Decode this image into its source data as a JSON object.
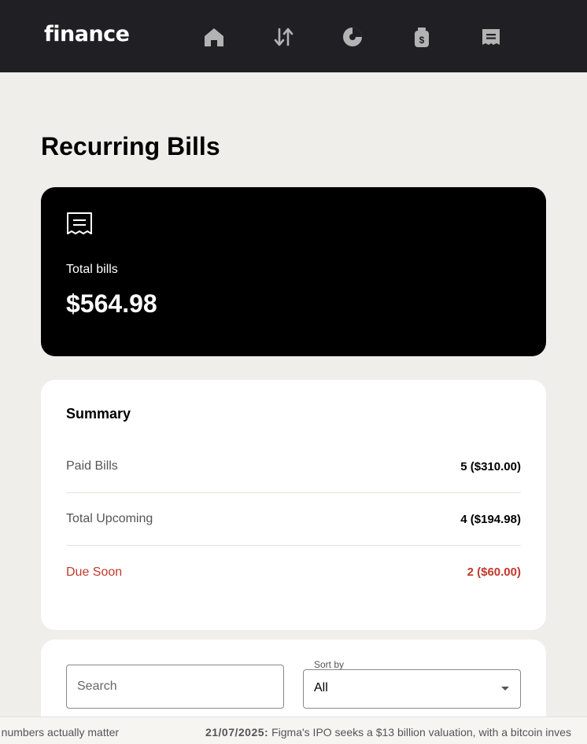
{
  "header": {
    "logo": "finance",
    "nav": [
      {
        "icon": "home-icon"
      },
      {
        "icon": "transactions-icon"
      },
      {
        "icon": "budgets-icon"
      },
      {
        "icon": "pots-icon"
      },
      {
        "icon": "recurring-bills-icon"
      }
    ]
  },
  "page": {
    "title": "Recurring Bills"
  },
  "total": {
    "icon": "receipt-icon",
    "label": "Total bills",
    "value": "$564.98"
  },
  "summary": {
    "title": "Summary",
    "rows": [
      {
        "label": "Paid Bills",
        "value": "5 ($310.00)"
      },
      {
        "label": "Total Upcoming",
        "value": "4 ($194.98)"
      },
      {
        "label": "Due Soon",
        "value": "2 ($60.00)"
      }
    ]
  },
  "filters": {
    "search_placeholder": "Search",
    "sort_label": "Sort by",
    "sort_value": "All"
  },
  "ticker": {
    "lead_text": "e numbers actually matter",
    "date": "21/07/2025:",
    "headline": "Figma's IPO seeks a $13 billion valuation, with a bitcoin inves"
  },
  "colors": {
    "header_bg": "#201F24",
    "page_bg": "#F0EEEA",
    "due_soon": "#C0392B"
  }
}
